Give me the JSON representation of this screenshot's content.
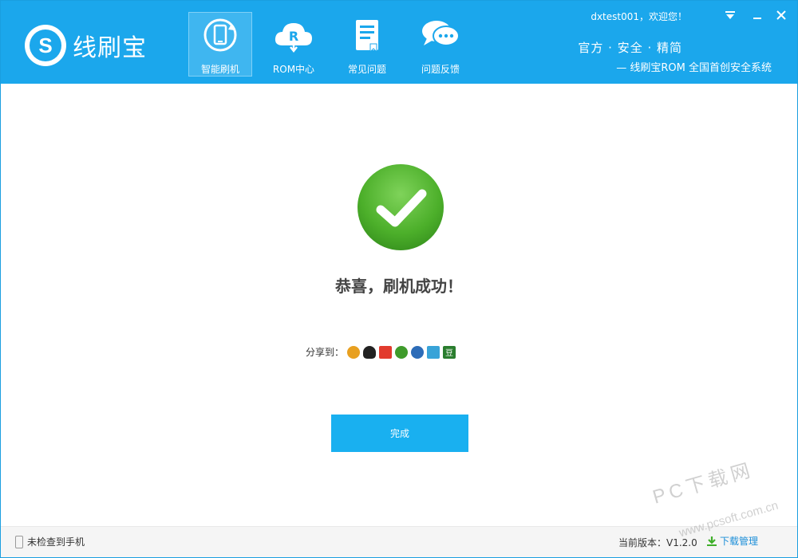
{
  "app": {
    "logo_text": "线刷宝",
    "logo_letter": "S"
  },
  "nav": [
    {
      "label": "智能刷机",
      "icon": "smart-flash-icon",
      "active": true
    },
    {
      "label": "ROM中心",
      "icon": "rom-cloud-icon",
      "active": false
    },
    {
      "label": "常见问题",
      "icon": "faq-document-icon",
      "active": false
    },
    {
      "label": "问题反馈",
      "icon": "feedback-chat-icon",
      "active": false
    }
  ],
  "user": {
    "greeting": "dxtest001，欢迎您！"
  },
  "slogan": {
    "top": "官方 · 安全 · 精简",
    "sub": "— 线刷宝ROM  全国首创安全系统"
  },
  "main": {
    "success_title": "恭喜，刷机成功！",
    "share_label": "分享到：",
    "share_icons": [
      {
        "name": "qzone-icon",
        "color": "#e8a020"
      },
      {
        "name": "qq-icon",
        "color": "#222222"
      },
      {
        "name": "weibo-icon",
        "color": "#e23b2e"
      },
      {
        "name": "kaixin-icon",
        "color": "#3f9b2b"
      },
      {
        "name": "renren-icon",
        "color": "#2d6cb8"
      },
      {
        "name": "pengyou-icon",
        "color": "#38a3d8"
      },
      {
        "name": "douban-icon",
        "color": "#2a7d2e",
        "glyph": "豆"
      }
    ],
    "done_button": "完成"
  },
  "footer": {
    "phone_status": "未检查到手机",
    "version": "当前版本：V1.2.0",
    "download_manage": "下载管理"
  },
  "watermark": {
    "text": "PC下载网",
    "url": "www.pcsoft.com.cn"
  },
  "colors": {
    "header": "#1ba7ec",
    "button": "#19b0f0",
    "success_green": "#4caf2a"
  }
}
